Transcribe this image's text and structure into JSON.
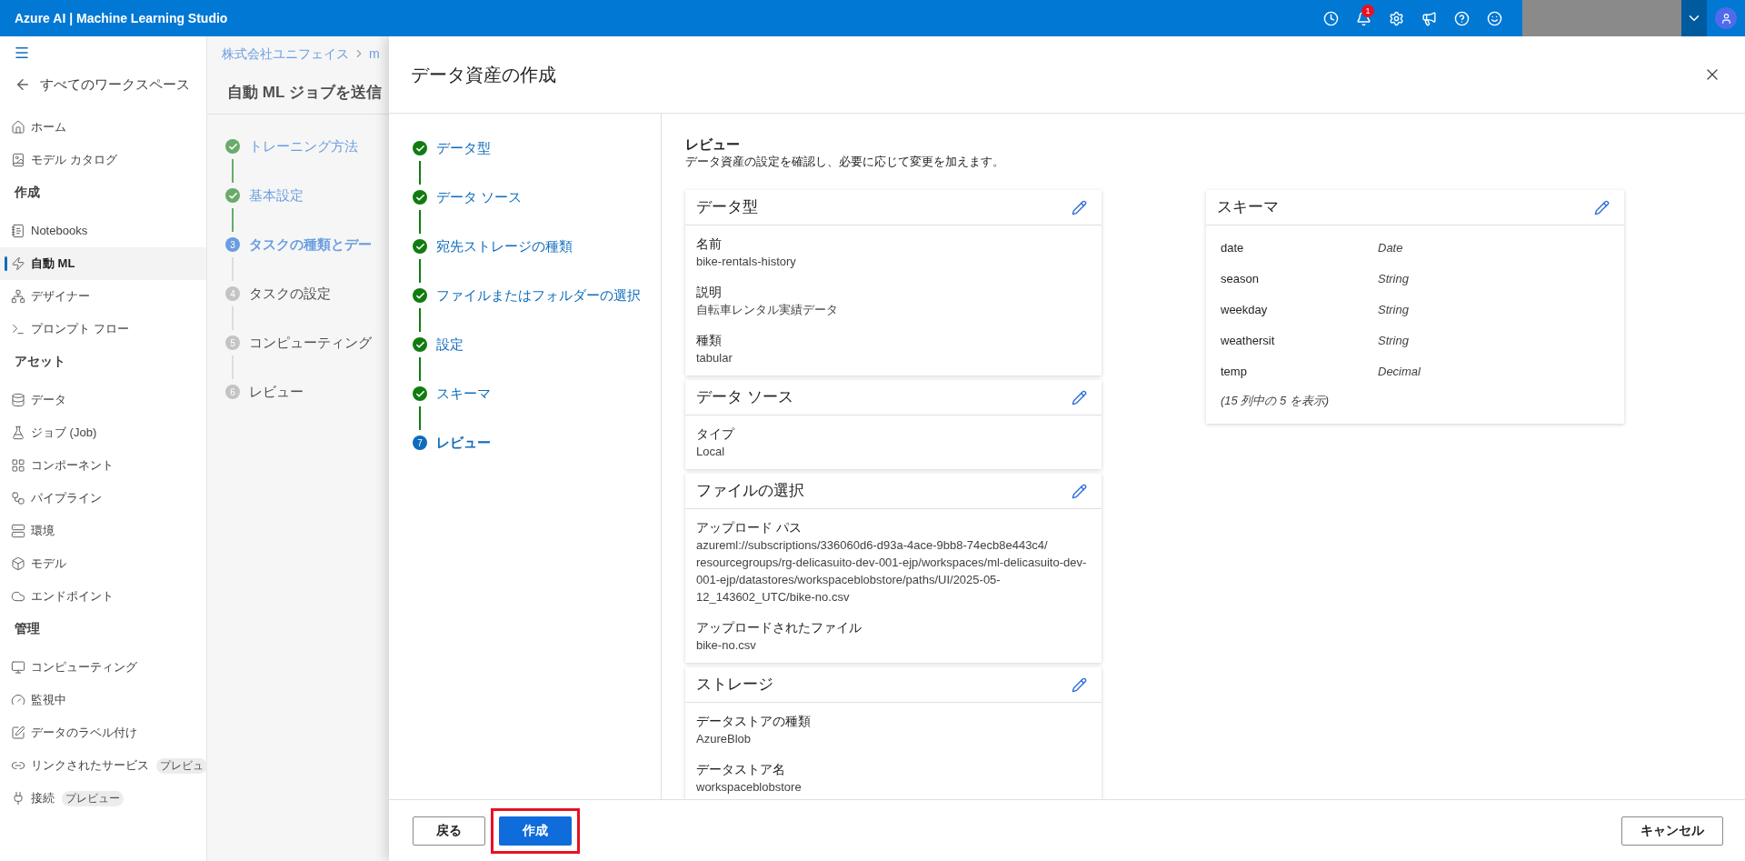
{
  "top_bar": {
    "title": "Azure AI | Machine Learning Studio",
    "notification_count": "1"
  },
  "sidebar": {
    "back": "すべてのワークスペース",
    "sections": [
      {
        "items": [
          {
            "label": "ホーム",
            "selected": false
          },
          {
            "label": "モデル カタログ",
            "selected": false
          }
        ]
      },
      {
        "heading": "作成",
        "items": [
          {
            "label": "Notebooks",
            "selected": false
          },
          {
            "label": "自動 ML",
            "selected": true
          },
          {
            "label": "デザイナー",
            "selected": false
          },
          {
            "label": "プロンプト フロー",
            "selected": false
          }
        ]
      },
      {
        "heading": "アセット",
        "items": [
          {
            "label": "データ",
            "selected": false
          },
          {
            "label": "ジョブ (Job)",
            "selected": false
          },
          {
            "label": "コンポーネント",
            "selected": false
          },
          {
            "label": "パイプライン",
            "selected": false
          },
          {
            "label": "環境",
            "selected": false
          },
          {
            "label": "モデル",
            "selected": false
          },
          {
            "label": "エンドポイント",
            "selected": false
          }
        ]
      },
      {
        "heading": "管理",
        "items": [
          {
            "label": "コンピューティング",
            "selected": false
          },
          {
            "label": "監視中",
            "selected": false
          },
          {
            "label": "データのラベル付け",
            "selected": false
          },
          {
            "label": "リンクされたサービス",
            "selected": false,
            "badge": "プレビュ"
          },
          {
            "label": "接続",
            "selected": false,
            "badge": "プレビュー"
          }
        ]
      }
    ]
  },
  "wizard": {
    "breadcrumb": [
      "株式会社ユニフェイス",
      "m"
    ],
    "title": "自動 ML ジョブを送信",
    "steps": [
      {
        "label": "トレーニング方法",
        "completed": true,
        "selected": false
      },
      {
        "label": "基本設定",
        "completed": true,
        "selected": false
      },
      {
        "label": "タスクの種類とデー",
        "completed": false,
        "selected": true,
        "number": "3"
      },
      {
        "label": "タスクの設定",
        "completed": false,
        "selected": false,
        "number": "4"
      },
      {
        "label": "コンピューティング",
        "completed": false,
        "selected": false,
        "number": "5"
      },
      {
        "label": "レビュー",
        "completed": false,
        "selected": false,
        "number": "6"
      }
    ]
  },
  "panel": {
    "title": "データ資産の作成",
    "steps": [
      {
        "label": "データ型",
        "completed": true,
        "selected": false
      },
      {
        "label": "データ ソース",
        "completed": true,
        "selected": false
      },
      {
        "label": "宛先ストレージの種類",
        "completed": true,
        "selected": false
      },
      {
        "label": "ファイルまたはフォルダーの選択",
        "completed": true,
        "selected": false
      },
      {
        "label": "設定",
        "completed": true,
        "selected": false
      },
      {
        "label": "スキーマ",
        "completed": true,
        "selected": false
      },
      {
        "label": "レビュー",
        "completed": false,
        "selected": true,
        "number": "7"
      }
    ],
    "review": {
      "heading": "レビュー",
      "description": "データ資産の設定を確認し、必要に応じて変更を加えます。",
      "cards": [
        {
          "title": "データ型",
          "fields": [
            {
              "label": "名前",
              "value": "bike-rentals-history"
            },
            {
              "label": "説明",
              "value": "自転車レンタル実績データ"
            },
            {
              "label": "種類",
              "value": "tabular"
            }
          ]
        },
        {
          "title": "データ ソース",
          "fields": [
            {
              "label": "タイプ",
              "value": "Local"
            }
          ]
        },
        {
          "title": "ファイルの選択",
          "fields": [
            {
              "label": "アップロード パス",
              "value": "azureml://subscriptions/336060d6-d93a-4ace-9bb8-74ecb8e443c4/resourcegroups/rg-delicasuito-dev-001-ejp/workspaces/ml-delicasuito-dev-001-ejp/datastores/workspaceblobstore/paths/UI/2025-05-12_143602_UTC/bike-no.csv"
            },
            {
              "label": "アップロードされたファイル",
              "value": "bike-no.csv"
            }
          ]
        },
        {
          "title": "ストレージ",
          "fields": [
            {
              "label": "データストアの種類",
              "value": "AzureBlob"
            },
            {
              "label": "データストア名",
              "value": "workspaceblobstore"
            }
          ]
        }
      ],
      "schema": {
        "title": "スキーマ",
        "rows": [
          {
            "name": "date",
            "type": "Date"
          },
          {
            "name": "season",
            "type": "String"
          },
          {
            "name": "weekday",
            "type": "String"
          },
          {
            "name": "weathersit",
            "type": "String"
          },
          {
            "name": "temp",
            "type": "Decimal"
          }
        ],
        "footer": "(15 列中の 5 を表示)"
      }
    },
    "footer": {
      "back": "戻る",
      "create": {
        "label": "作成",
        "highlighted": true
      },
      "cancel": "キャンセル"
    }
  }
}
